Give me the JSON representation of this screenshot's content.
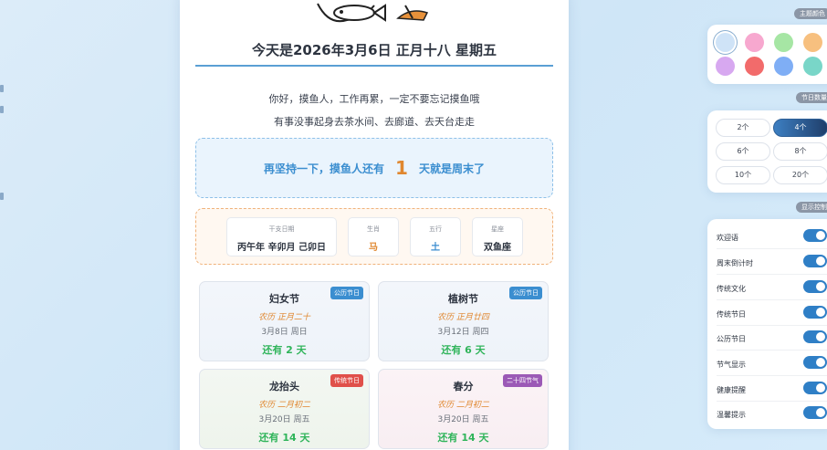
{
  "header": {
    "date_title": "今天是2026年3月6日 正月十八 星期五"
  },
  "greeting": {
    "line1": "你好，摸鱼人，工作再累，一定不要忘记摸鱼哦",
    "line2": "有事没事起身去茶水间、去廊道、去天台走走"
  },
  "weekend": {
    "prefix": "再坚持一下，摸鱼人还有",
    "days": "1",
    "suffix": "天就是周末了"
  },
  "info": [
    {
      "label": "干支日期",
      "value": "丙午年 辛卯月 己卯日"
    },
    {
      "label": "生肖",
      "value": "马"
    },
    {
      "label": "五行",
      "value": "土"
    },
    {
      "label": "星座",
      "value": "双鱼座"
    }
  ],
  "festivals": [
    {
      "name": "妇女节",
      "tag": "公历节日",
      "lunar": "农历 正月二十",
      "solar": "3月8日 周日",
      "remain": "还有 2 天"
    },
    {
      "name": "植树节",
      "tag": "公历节日",
      "lunar": "农历 正月廿四",
      "solar": "3月12日 周四",
      "remain": "还有 6 天"
    },
    {
      "name": "龙抬头",
      "tag": "传统节日",
      "lunar": "农历 二月初二",
      "solar": "3月20日 周五",
      "remain": "还有 14 天"
    },
    {
      "name": "春分",
      "tag": "二十四节气",
      "lunar": "农历 二月初二",
      "solar": "3月20日 周五",
      "remain": "还有 14 天"
    }
  ],
  "settings": {
    "theme_title": "主题颜色",
    "theme_colors": [
      "#cfe3f7",
      "#f7a8cf",
      "#a6e6a4",
      "#f7c07f",
      "#d7a8f0",
      "#f26b6b",
      "#7faef5",
      "#79d6c8"
    ],
    "count_title": "节日数量",
    "counts": [
      "2个",
      "4个",
      "6个",
      "8个",
      "10个",
      "20个"
    ],
    "count_selected": "4个",
    "display_title": "显示控制",
    "toggles": [
      {
        "label": "欢迎语",
        "on": true
      },
      {
        "label": "周末倒计时",
        "on": true
      },
      {
        "label": "传统文化",
        "on": true
      },
      {
        "label": "传统节日",
        "on": true
      },
      {
        "label": "公历节日",
        "on": true
      },
      {
        "label": "节气显示",
        "on": true
      },
      {
        "label": "健康提醒",
        "on": true
      },
      {
        "label": "温馨提示",
        "on": true
      }
    ]
  },
  "colors": {
    "accent": "#3b8ed0",
    "orange": "#e0872f",
    "green": "#2fb45a",
    "tag_solar": "#3b8ed0",
    "tag_traditional": "#e0504a",
    "tag_solarterm": "#9b59b6"
  }
}
